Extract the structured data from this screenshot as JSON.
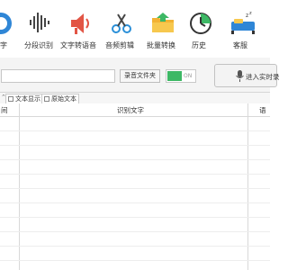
{
  "toolbar": {
    "items": [
      {
        "label": "字",
        "icon": "speech-to-text-icon"
      },
      {
        "label": "分段识别",
        "icon": "segment-recognition-icon"
      },
      {
        "label": "文字转语音",
        "icon": "text-to-speech-icon"
      },
      {
        "label": "音频剪辑",
        "icon": "audio-cut-icon"
      },
      {
        "label": "批量转换",
        "icon": "batch-convert-icon"
      },
      {
        "label": "历史",
        "icon": "history-icon"
      },
      {
        "label": "客服",
        "icon": "customer-service-icon"
      }
    ]
  },
  "input_bar": {
    "path_value": "",
    "record_file_button": "录音文件夹",
    "toggle_state_text": "ON",
    "voice_button": "进入实时录"
  },
  "tabs": {
    "text_display": "文本显示",
    "original_text": "原始文本"
  },
  "table": {
    "columns": [
      "间",
      "识别文字",
      "语"
    ]
  },
  "colors": {
    "accent_green": "#3db865",
    "header_border": "#d8d8d8"
  }
}
